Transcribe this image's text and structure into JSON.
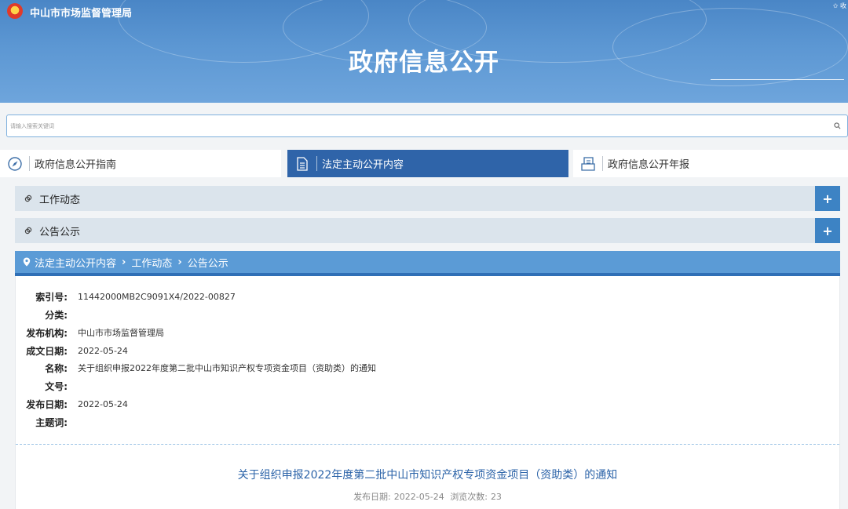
{
  "header": {
    "site_name": "中山市市场监督管理局",
    "page_heading": "政府信息公开",
    "top_right": "✩ 收"
  },
  "search": {
    "placeholder": "请输入搜索关键词"
  },
  "tabs": [
    {
      "label": "政府信息公开指南",
      "icon": "compass-icon",
      "active": false
    },
    {
      "label": "法定主动公开内容",
      "icon": "document-icon",
      "active": true
    },
    {
      "label": "政府信息公开年报",
      "icon": "report-icon",
      "active": false
    }
  ],
  "sections": [
    {
      "label": "工作动态",
      "button": "+"
    },
    {
      "label": "公告公示",
      "button": "+"
    }
  ],
  "breadcrumb": {
    "items": [
      "法定主动公开内容",
      "工作动态",
      "公告公示"
    ],
    "separator": "›"
  },
  "meta": [
    {
      "label": "索引号:",
      "value": "11442000MB2C9091X4/2022-00827"
    },
    {
      "label": "分类:",
      "value": ""
    },
    {
      "label": "发布机构:",
      "value": "中山市市场监督管理局"
    },
    {
      "label": "成文日期:",
      "value": "2022-05-24"
    },
    {
      "label": "名称:",
      "value": "关于组织申报2022年度第二批中山市知识产权专项资金项目（资助类）的通知"
    },
    {
      "label": "文号:",
      "value": ""
    },
    {
      "label": "发布日期:",
      "value": "2022-05-24"
    },
    {
      "label": "主题词:",
      "value": ""
    }
  ],
  "article": {
    "title": "关于组织申报2022年度第二批中山市知识产权专项资金项目（资助类）的通知",
    "publish_label": "发布日期:",
    "publish_date": "2022-05-24",
    "views_label": "浏览次数:",
    "views": "23"
  },
  "colors": {
    "banner": "#5c97d3",
    "active_tab": "#2f64a9",
    "accordion_bg": "#dbe4ec",
    "plus_button": "#3d83c4",
    "breadcrumb_bg": "#5b9bd6",
    "title_text": "#2b63a8"
  }
}
